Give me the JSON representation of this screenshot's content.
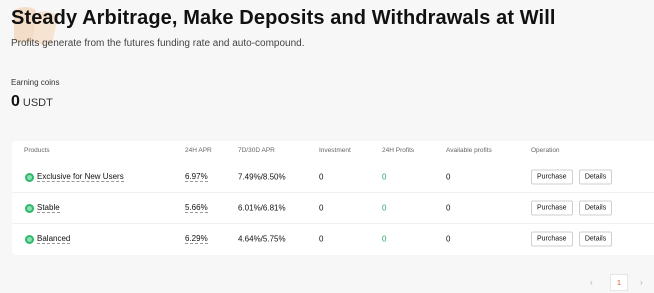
{
  "hero": {
    "title": "Steady Arbitrage, Make Deposits and Withdrawals at Will",
    "subtitle": "Profits generate from the futures funding rate and auto-compound."
  },
  "earning": {
    "label": "Earning coins",
    "value": "0",
    "unit": "USDT"
  },
  "table": {
    "headers": {
      "products": "Products",
      "apr24h": "24H APR",
      "apr7d30d": "7D/30D APR",
      "investment": "Investment",
      "profits24h": "24H Profits",
      "available": "Available profits",
      "operation": "Operation"
    },
    "rows": [
      {
        "name": "Exclusive for New Users",
        "apr24h": "6.97%",
        "apr7d30d": "7.49%/8.50%",
        "investment": "0",
        "profits24h": "0",
        "available": "0",
        "purchase": "Purchase",
        "details": "Details"
      },
      {
        "name": "Stable",
        "apr24h": "5.66%",
        "apr7d30d": "6.01%/6.81%",
        "investment": "0",
        "profits24h": "0",
        "available": "0",
        "purchase": "Purchase",
        "details": "Details"
      },
      {
        "name": "Balanced",
        "apr24h": "6.29%",
        "apr7d30d": "4.64%/5.75%",
        "investment": "0",
        "profits24h": "0",
        "available": "0",
        "purchase": "Purchase",
        "details": "Details"
      }
    ]
  },
  "pagination": {
    "prev": "‹",
    "current": "1",
    "next": "›"
  },
  "colors": {
    "accent_green": "#25a95b",
    "coin_icon": "#2fb76b",
    "page_active": "#e2562a",
    "brand_mark": "#f3c9a3"
  },
  "icons": {
    "brand": "brand-logo-mark",
    "product": "coin-icon",
    "prev": "chevron-left-icon",
    "next": "chevron-right-icon"
  }
}
